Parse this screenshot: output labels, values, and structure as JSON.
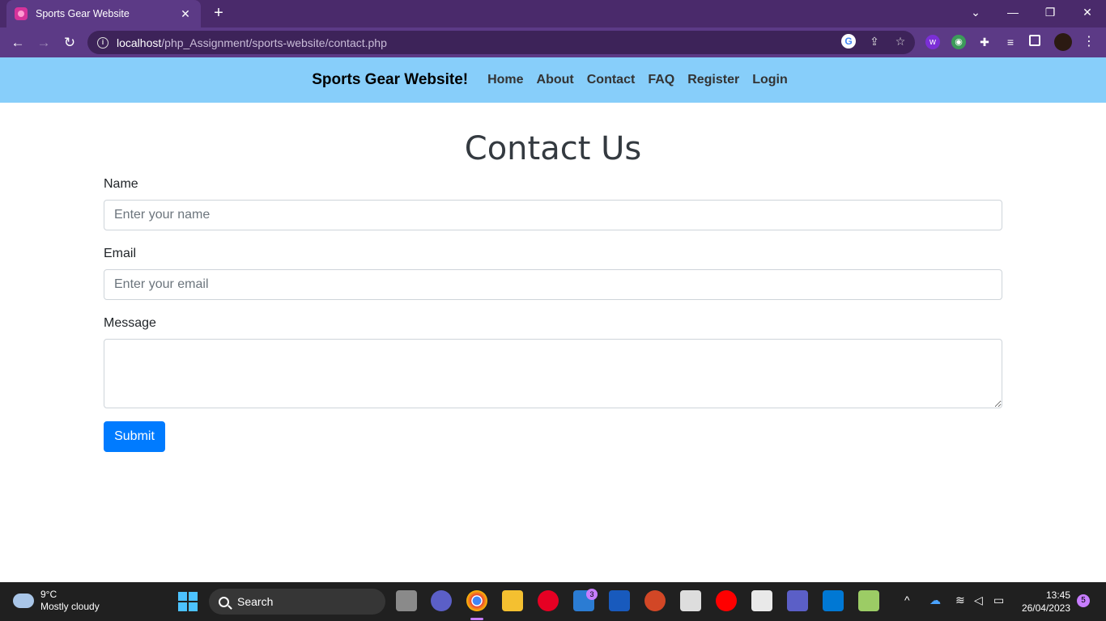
{
  "browser": {
    "tab_title": "Sports Gear Website",
    "url_host": "localhost",
    "url_path": "/php_Assignment/sports-website/contact.php"
  },
  "site": {
    "brand": "Sports Gear Website!",
    "nav": [
      "Home",
      "About",
      "Contact",
      "FAQ",
      "Register",
      "Login"
    ]
  },
  "contact": {
    "title": "Contact Us",
    "name_label": "Name",
    "name_placeholder": "Enter your name",
    "email_label": "Email",
    "email_placeholder": "Enter your email",
    "message_label": "Message",
    "submit_label": "Submit"
  },
  "taskbar": {
    "temperature": "9°C",
    "weather": "Mostly cloudy",
    "search_label": "Search",
    "mail_badge": "3",
    "time": "13:45",
    "date": "26/04/2023",
    "notifications": "5"
  },
  "colors": {
    "chrome": "#5c3a86",
    "nav_bg": "#87cefa",
    "primary_button": "#007bff"
  }
}
